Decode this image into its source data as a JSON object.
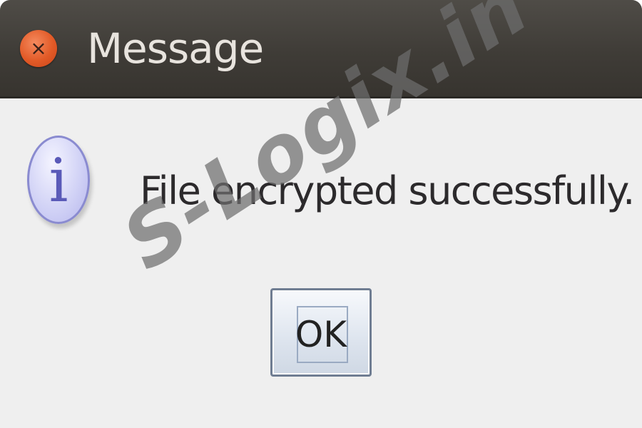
{
  "window": {
    "title": "Message",
    "close_icon": "close-icon",
    "close_glyph": "×"
  },
  "dialog": {
    "icon": "info-icon",
    "icon_glyph": "i",
    "message": "File encrypted successfully.",
    "ok_label": "OK"
  },
  "watermark": {
    "text": "S-Logix.in"
  },
  "colors": {
    "titlebar": "#3f3c37",
    "close_button": "#e25a27",
    "dialog_background": "#efefef",
    "info_icon": "#cfd0f5"
  }
}
